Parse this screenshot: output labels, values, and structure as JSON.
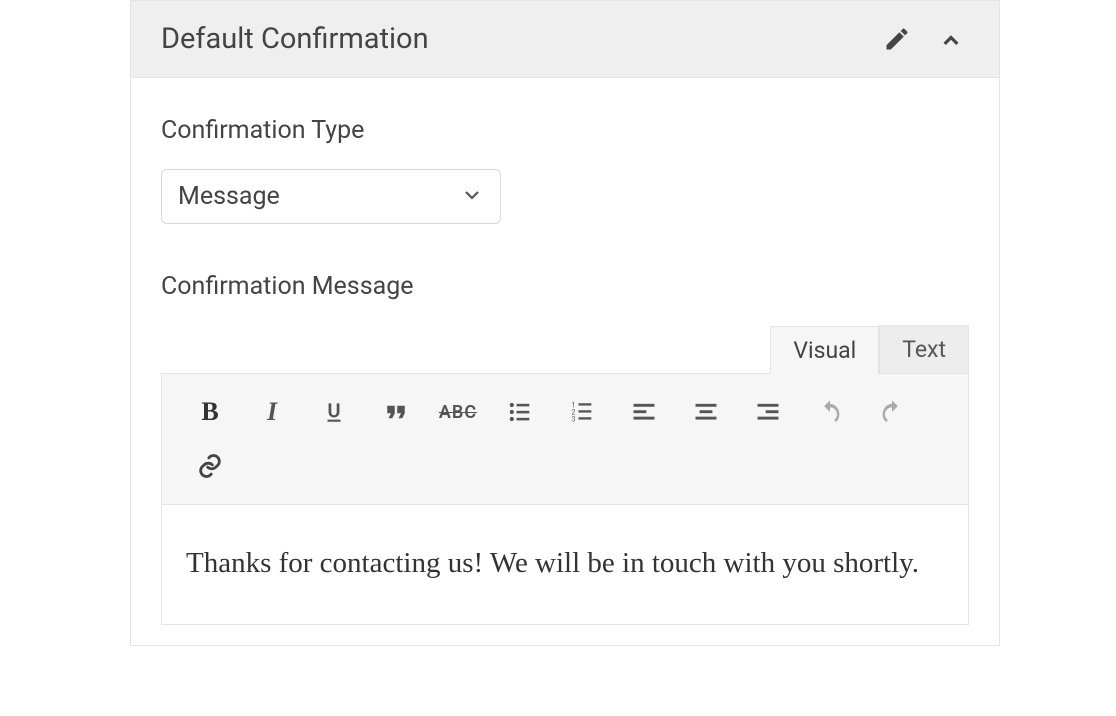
{
  "panel": {
    "title": "Default Confirmation"
  },
  "fields": {
    "type_label": "Confirmation Type",
    "type_value": "Message",
    "message_label": "Confirmation Message"
  },
  "editor": {
    "tabs": {
      "visual": "Visual",
      "text": "Text"
    },
    "toolbar": {
      "bold": "B",
      "italic": "I",
      "strike": "ABC"
    },
    "content": "Thanks for contacting us! We will be in touch with you shortly."
  }
}
